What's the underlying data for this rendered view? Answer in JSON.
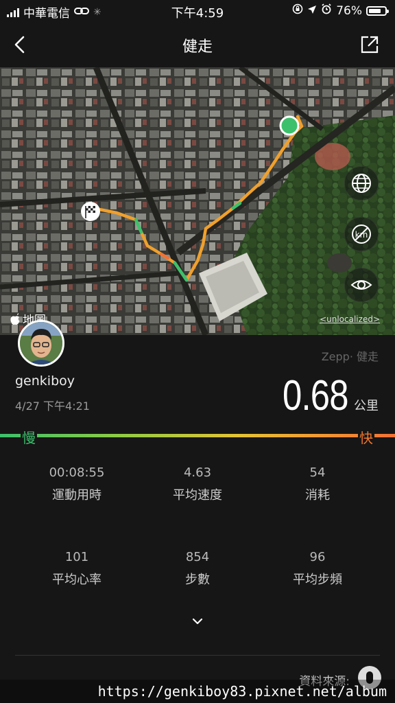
{
  "status_bar": {
    "carrier": "中華電信",
    "time": "下午4:59",
    "battery": "76%",
    "battery_level": 0.76
  },
  "nav": {
    "title": "健走"
  },
  "map": {
    "attribution": "地圖",
    "unlocalized_label": "<unlocalized>",
    "controls": [
      "globe-icon",
      "no-km-icon",
      "eye-icon"
    ]
  },
  "activity": {
    "username": "genkiboy",
    "date": "4/27 下午4:21",
    "source": "Zepp· 健走",
    "distance": "0.68",
    "distance_unit": "公里"
  },
  "speed_scale": {
    "slow": "慢",
    "fast": "快",
    "colors": [
      "#3cc06c",
      "#f27134"
    ]
  },
  "stats": [
    {
      "value": "00:08:55",
      "label": "運動用時"
    },
    {
      "value": "4.63",
      "label": "平均速度"
    },
    {
      "value": "54",
      "label": "消耗"
    },
    {
      "value": "101",
      "label": "平均心率"
    },
    {
      "value": "854",
      "label": "步數"
    },
    {
      "value": "96",
      "label": "平均步頻"
    }
  ],
  "footer": {
    "data_source": "資料來源:",
    "watermark": "https://genkiboy83.pixnet.net/album"
  }
}
